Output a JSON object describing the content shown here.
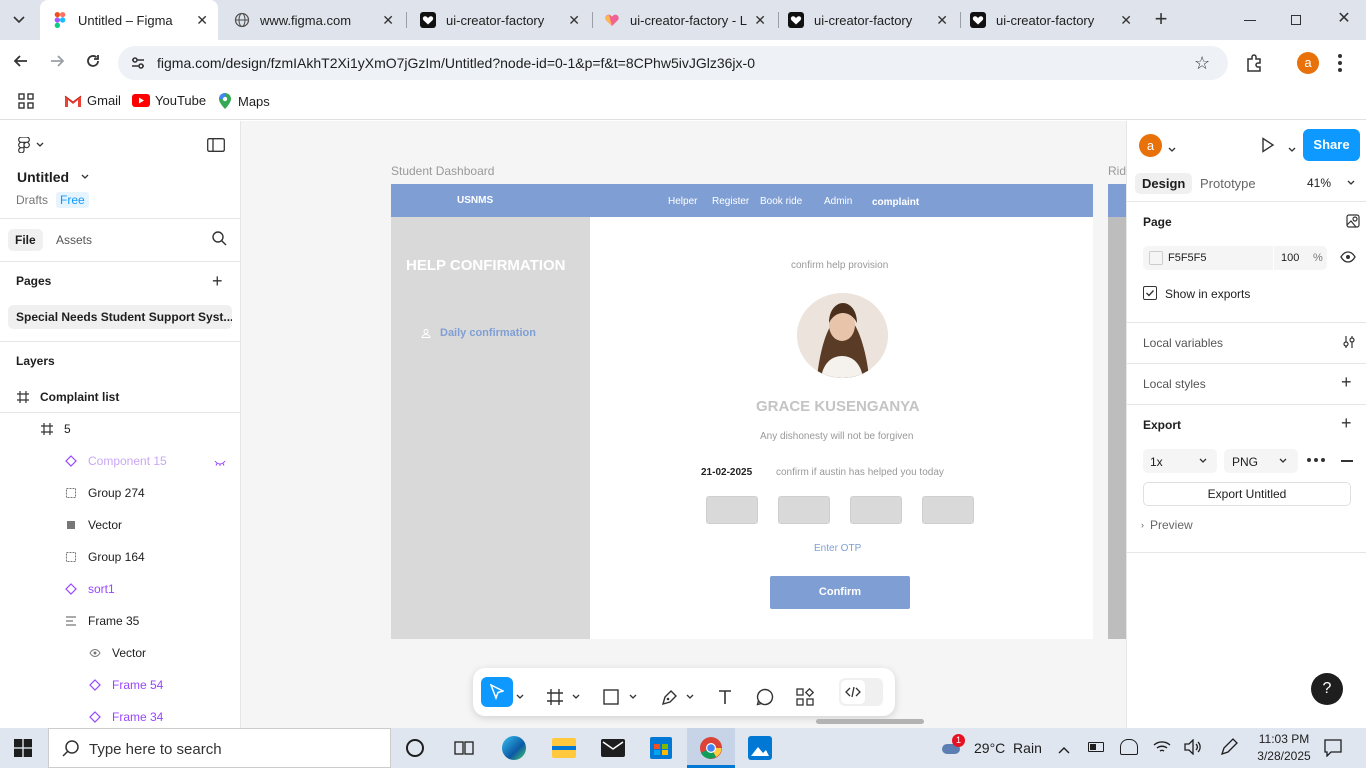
{
  "browser": {
    "tabs": [
      {
        "title": "Untitled – Figma",
        "active": true
      },
      {
        "title": "www.figma.com"
      },
      {
        "title": "ui-creator-factory"
      },
      {
        "title": "ui-creator-factory - L"
      },
      {
        "title": "ui-creator-factory"
      },
      {
        "title": "ui-creator-factory"
      }
    ],
    "url": "figma.com/design/fzmIAkhT2Xi1yXmO7jGzIm/Untitled?node-id=0-1&p=f&t=8CPhw5ivJGlz36jx-0",
    "bookmarks": [
      "Gmail",
      "YouTube",
      "Maps"
    ],
    "profile_initial": "a"
  },
  "figma": {
    "file_name": "Untitled",
    "drafts_label": "Drafts",
    "plan_badge": "Free",
    "tabs": {
      "file": "File",
      "assets": "Assets"
    },
    "pages_heading": "Pages",
    "current_page": "Special Needs Student Support Syst...",
    "layers_heading": "Layers",
    "layers": [
      {
        "name": "Complaint list",
        "icon": "frame-icon",
        "level": 0
      },
      {
        "name": "5",
        "icon": "frame-icon",
        "level": 1
      },
      {
        "name": "Component 15",
        "icon": "component-icon",
        "level": 2,
        "muted": true
      },
      {
        "name": "Group 274",
        "icon": "group-icon",
        "level": 2
      },
      {
        "name": "Vector",
        "icon": "vector-icon",
        "level": 2
      },
      {
        "name": "Group 164",
        "icon": "group-icon",
        "level": 2
      },
      {
        "name": "sort1",
        "icon": "component-icon",
        "level": 2,
        "purple": true
      },
      {
        "name": "Frame 35",
        "icon": "autolayout-icon",
        "level": 2
      },
      {
        "name": "Vector",
        "icon": "eye-icon",
        "level": 3
      },
      {
        "name": "Frame 54",
        "icon": "component-icon",
        "level": 3,
        "purple": true
      },
      {
        "name": "Frame 34",
        "icon": "component-icon",
        "level": 3,
        "purple": true
      }
    ]
  },
  "design": {
    "frame_label": "Student Dashboard",
    "frame_label_right": "Rid",
    "nav": {
      "logo": "USNMS",
      "links": [
        "Helper",
        "Register",
        "Book ride",
        "Admin",
        "complaint"
      ]
    },
    "sidebar_title": "HELP CONFIRMATION",
    "sidebar_item": "Daily confirmation",
    "subtitle": "confirm help provision",
    "person_name": "GRACE KUSENGANYA",
    "warning": "Any dishonesty will not be forgiven",
    "date": "21-02-2025",
    "prompt": "confirm if austin has helped you today",
    "otp_label": "Enter OTP",
    "confirm_button": "Confirm"
  },
  "right_panel": {
    "avatar_initial": "a",
    "share": "Share",
    "tabs": {
      "design": "Design",
      "prototype": "Prototype"
    },
    "zoom": "41%",
    "page_heading": "Page",
    "bg_color": "F5F5F5",
    "opacity": "100",
    "opacity_unit": "%",
    "show_in_exports": "Show in exports",
    "local_variables": "Local variables",
    "local_styles": "Local styles",
    "export_heading": "Export",
    "export_scale": "1x",
    "export_format": "PNG",
    "export_button": "Export Untitled",
    "preview": "Preview"
  },
  "taskbar": {
    "search_placeholder": "Type here to search",
    "weather": "29°C  Rain",
    "weather_badge": "1",
    "time": "11:03 PM",
    "date": "3/28/2025"
  },
  "colors": {
    "figma_blue": "#0d99ff",
    "nav_blue": "#7f9fd4",
    "sidebar_gray": "#d9d9d9",
    "purple_layer": "#9747ff"
  }
}
